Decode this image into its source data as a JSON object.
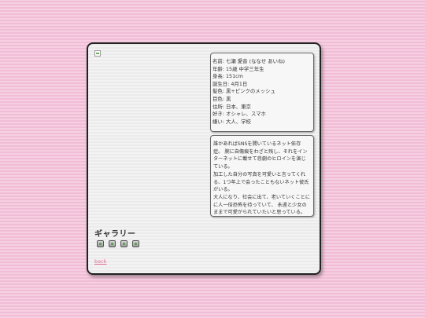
{
  "profile": {
    "lines": [
      "名前: 七瀬 愛音 (ななせ あいね)",
      "年齢: 15歳 中学三年生",
      "身長: 151cm",
      "誕生日: 4月1日",
      "髪色: 黒+ピンクのメッシュ",
      "目色: 黒",
      "住所: 日本、東京",
      "好き: オシャレ、スマホ",
      "嫌い: 大人、学校"
    ]
  },
  "description": {
    "lines": [
      "誰かあればSNSを開いているネット依存",
      "症。 腕に自傷痕をわざと残し、それをイン",
      "ターネットに載せて悲劇のヒロインを演じ",
      "ている。",
      "加工した自分の写真を可愛いと言ってくれ",
      "る、1つ年上で会ったこともないネット彼氏",
      "がいる。",
      "大人になり、社会に出て、老いていくことに",
      "に人一倍恐怖を待っていて、 永遠と少女の",
      "ままで可愛がられていたいと思っている。"
    ]
  },
  "gallery": {
    "title": "ギャラリー",
    "thumbnails": [
      "image-icon",
      "image-icon",
      "image-icon",
      "image-icon"
    ]
  },
  "back_link": "back"
}
